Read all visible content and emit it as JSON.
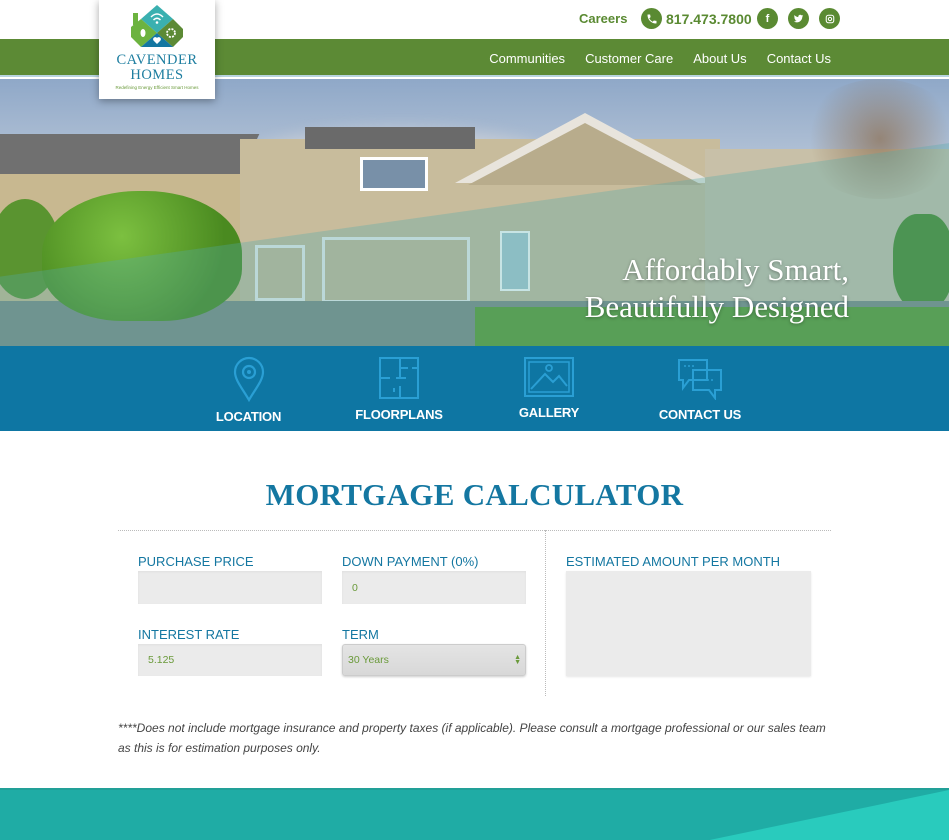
{
  "brand": {
    "name_line1": "CAVENDER",
    "name_line2": "HOMES",
    "tagline": "Redefining Energy Efficient Smart Homes",
    "colors": {
      "green": "#5c8a35",
      "blue": "#0e76a3",
      "title_blue": "#1477a1",
      "teal": "#1faca5"
    }
  },
  "topbar": {
    "careers_label": "Careers",
    "phone_icon": "phone-icon",
    "phone_number": "817.473.7800",
    "social": [
      {
        "icon": "facebook-icon",
        "glyph": "f"
      },
      {
        "icon": "twitter-icon",
        "glyph": "t"
      },
      {
        "icon": "instagram-icon",
        "glyph": "◎"
      }
    ]
  },
  "nav": {
    "items": [
      {
        "label": "Communities"
      },
      {
        "label": "Customer Care"
      },
      {
        "label": "About Us"
      },
      {
        "label": "Contact Us"
      }
    ]
  },
  "hero": {
    "headline_line1": "Affordably Smart,",
    "headline_line2": "Beautifully Designed"
  },
  "quicklinks": [
    {
      "label": "LOCATION",
      "icon": "map-pin-icon"
    },
    {
      "label": "FLOORPLANS",
      "icon": "floorplan-icon"
    },
    {
      "label": "GALLERY",
      "icon": "image-icon"
    },
    {
      "label": "CONTACT US",
      "icon": "chat-bubbles-icon"
    }
  ],
  "calculator": {
    "title": "MORTGAGE CALCULATOR",
    "purchase_price": {
      "label": "PURCHASE PRICE",
      "value": ""
    },
    "down_payment": {
      "label": "DOWN PAYMENT (0%)",
      "value": "0"
    },
    "interest_rate": {
      "label": "INTEREST RATE",
      "value": "5.125"
    },
    "term": {
      "label": "TERM",
      "selected": "30 Years"
    },
    "estimate": {
      "label": "ESTIMATED AMOUNT PER MONTH",
      "value": ""
    },
    "disclaimer": "****Does not include mortgage insurance and property taxes (if applicable). Please consult a mortgage professional or our sales team as this is for estimation purposes only."
  }
}
